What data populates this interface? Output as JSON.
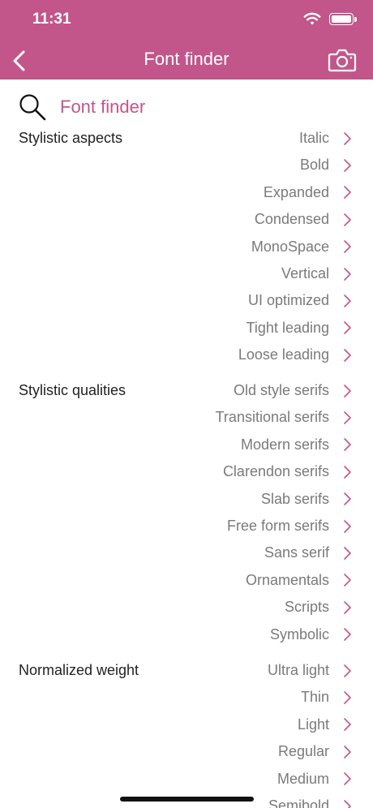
{
  "status": {
    "time": "11:31"
  },
  "nav": {
    "title": "Font finder"
  },
  "header": {
    "title": "Font finder"
  },
  "colors": {
    "accent": "#c2568a",
    "chevron": "#c2568a",
    "item_text": "#7a7a7a"
  },
  "sections": [
    {
      "label": "Stylistic aspects",
      "items": [
        "Italic",
        "Bold",
        "Expanded",
        "Condensed",
        "MonoSpace",
        "Vertical",
        "UI optimized",
        "Tight leading",
        "Loose leading"
      ]
    },
    {
      "label": "Stylistic qualities",
      "items": [
        "Old style serifs",
        "Transitional serifs",
        "Modern serifs",
        "Clarendon serifs",
        "Slab serifs",
        "Free form serifs",
        "Sans serif",
        "Ornamentals",
        "Scripts",
        "Symbolic"
      ]
    },
    {
      "label": "Normalized weight",
      "items": [
        "Ultra light",
        "Thin",
        "Light",
        "Regular",
        "Medium",
        "Semibold"
      ]
    }
  ]
}
